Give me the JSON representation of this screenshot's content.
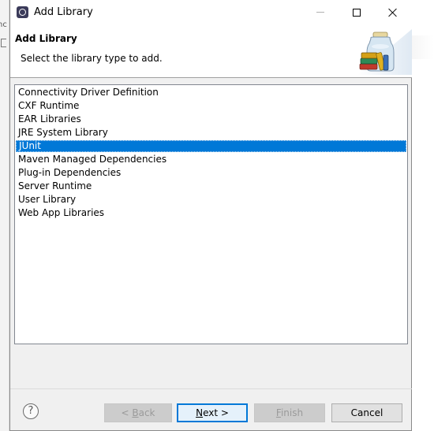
{
  "background": {
    "fragment": "nc"
  },
  "window": {
    "title": "Add Library"
  },
  "header": {
    "title": "Add Library",
    "message": "Select the library type to add.",
    "image_icon": "jar-library-icon"
  },
  "library_types": [
    "Connectivity Driver Definition",
    "CXF Runtime",
    "EAR Libraries",
    "JRE System Library",
    "JUnit",
    "Maven Managed Dependencies",
    "Plug-in Dependencies",
    "Server Runtime",
    "User Library",
    "Web App Libraries"
  ],
  "selected_library": "JUnit",
  "buttons": {
    "help": "?",
    "back": {
      "prefix": "< ",
      "mnemonic": "B",
      "rest": "ack"
    },
    "next": {
      "mnemonic": "N",
      "rest": "ext >"
    },
    "finish": {
      "mnemonic": "F",
      "rest": "inish"
    },
    "cancel": "Cancel"
  },
  "colors": {
    "selection": "#0078d7",
    "dialog_bg": "#f0f0f0"
  }
}
